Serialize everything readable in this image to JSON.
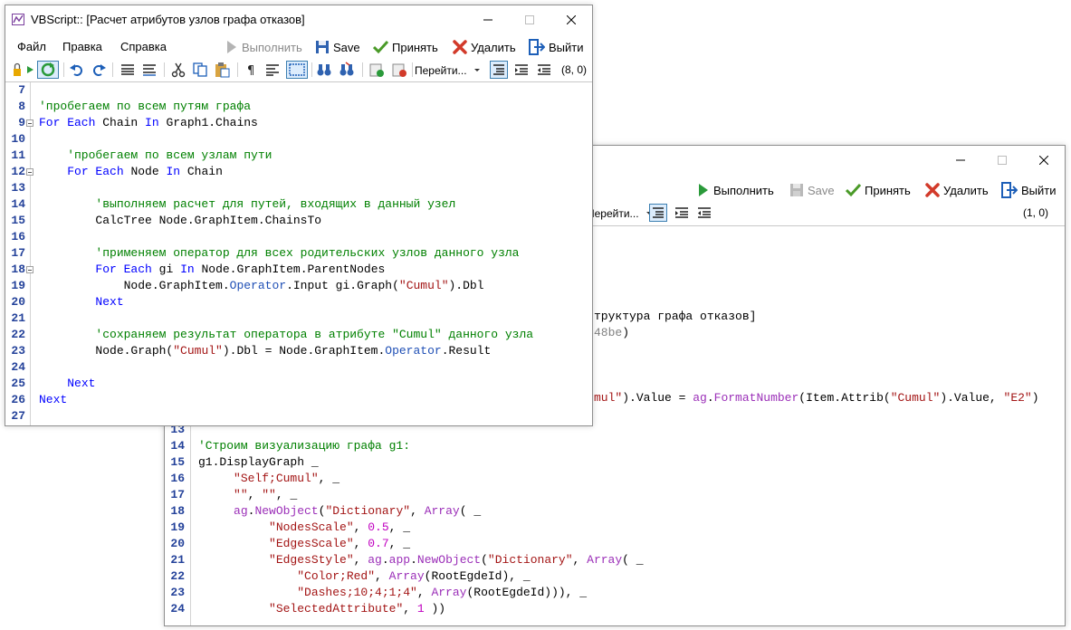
{
  "window_a": {
    "title": "VBScript:: [Расчет атрибутов узлов графа отказов]",
    "menu": [
      "Файл",
      "Правка",
      "Справка"
    ],
    "run_label": "Выполнить",
    "save_label": "Save",
    "accept_label": "Принять",
    "delete_label": "Удалить",
    "exit_label": "Выйти",
    "goto_label": "Перейти...",
    "cursor_pos": "(8, 0)",
    "lines": [
      {
        "n": "7",
        "t": [
          {
            "c": "",
            "s": ""
          }
        ]
      },
      {
        "n": "8",
        "t": [
          {
            "c": "cm",
            "s": "'пробегаем по всем путям графа"
          }
        ]
      },
      {
        "n": "9",
        "fold": true,
        "t": [
          {
            "c": "kw",
            "s": "For Each"
          },
          {
            "c": "",
            "s": " Chain "
          },
          {
            "c": "kw",
            "s": "In"
          },
          {
            "c": "",
            "s": " Graph1.Chains"
          }
        ]
      },
      {
        "n": "10",
        "t": [
          {
            "c": "",
            "s": ""
          }
        ]
      },
      {
        "n": "11",
        "t": [
          {
            "c": "cm",
            "s": "    'пробегаем по всем узлам пути"
          }
        ]
      },
      {
        "n": "12",
        "fold": true,
        "t": [
          {
            "c": "",
            "s": "    "
          },
          {
            "c": "kw",
            "s": "For Each"
          },
          {
            "c": "",
            "s": " Node "
          },
          {
            "c": "kw",
            "s": "In"
          },
          {
            "c": "",
            "s": " Chain"
          }
        ]
      },
      {
        "n": "13",
        "t": [
          {
            "c": "",
            "s": ""
          }
        ]
      },
      {
        "n": "14",
        "t": [
          {
            "c": "cm",
            "s": "        'выполняем расчет для путей, входящих в данный узел"
          }
        ]
      },
      {
        "n": "15",
        "t": [
          {
            "c": "",
            "s": "        CalcTree Node.GraphItem.ChainsTo"
          }
        ]
      },
      {
        "n": "16",
        "t": [
          {
            "c": "",
            "s": ""
          }
        ]
      },
      {
        "n": "17",
        "t": [
          {
            "c": "cm",
            "s": "        'применяем оператор для всех родительских узлов данного узла"
          }
        ]
      },
      {
        "n": "18",
        "fold": true,
        "t": [
          {
            "c": "",
            "s": "        "
          },
          {
            "c": "kw",
            "s": "For Each"
          },
          {
            "c": "",
            "s": " gi "
          },
          {
            "c": "kw",
            "s": "In"
          },
          {
            "c": "",
            "s": " Node.GraphItem.ParentNodes"
          }
        ]
      },
      {
        "n": "19",
        "t": [
          {
            "c": "",
            "s": "            Node.GraphItem."
          },
          {
            "c": "op",
            "s": "Operator"
          },
          {
            "c": "",
            "s": ".Input gi.Graph("
          },
          {
            "c": "st",
            "s": "\"Cumul\""
          },
          {
            "c": "",
            "s": ").Dbl"
          }
        ]
      },
      {
        "n": "20",
        "t": [
          {
            "c": "",
            "s": "        "
          },
          {
            "c": "kw",
            "s": "Next"
          }
        ]
      },
      {
        "n": "21",
        "t": [
          {
            "c": "",
            "s": ""
          }
        ]
      },
      {
        "n": "22",
        "t": [
          {
            "c": "cm",
            "s": "        'сохраняем результат оператора в атрибуте \"Cumul\" данного узла"
          }
        ]
      },
      {
        "n": "23",
        "t": [
          {
            "c": "",
            "s": "        Node.Graph("
          },
          {
            "c": "st",
            "s": "\"Cumul\""
          },
          {
            "c": "",
            "s": ").Dbl = Node.GraphItem."
          },
          {
            "c": "op",
            "s": "Operator"
          },
          {
            "c": "",
            "s": ".Result"
          }
        ]
      },
      {
        "n": "24",
        "t": [
          {
            "c": "",
            "s": ""
          }
        ]
      },
      {
        "n": "25",
        "t": [
          {
            "c": "",
            "s": "    "
          },
          {
            "c": "kw",
            "s": "Next"
          }
        ]
      },
      {
        "n": "26",
        "t": [
          {
            "c": "kw",
            "s": "Next"
          }
        ]
      },
      {
        "n": "27",
        "t": [
          {
            "c": "",
            "s": ""
          }
        ]
      }
    ]
  },
  "window_b": {
    "run_label": "Выполнить",
    "save_label": "Save",
    "accept_label": "Принять",
    "delete_label": "Удалить",
    "exit_label": "Выйти",
    "goto_label": "Перейти...",
    "cursor_pos": "(1, 0)",
    "visible_fragments": [
      {
        "t": [
          {
            "c": "",
            "s": "труктура графа отказов]"
          }
        ]
      },
      {
        "t": [
          {
            "c": "gray",
            "s": "48be"
          },
          {
            "c": "",
            "s": ")"
          }
        ]
      },
      {
        "t": [
          {
            "c": "st",
            "s": "mul\""
          },
          {
            "c": "",
            "s": ").Value = "
          },
          {
            "c": "ag",
            "s": "ag"
          },
          {
            "c": "",
            "s": "."
          },
          {
            "c": "ag",
            "s": "FormatNumber"
          },
          {
            "c": "",
            "s": "(Item.Attrib("
          },
          {
            "c": "st",
            "s": "\"Cumul\""
          },
          {
            "c": "",
            "s": ").Value, "
          },
          {
            "c": "st",
            "s": "\"E2\""
          },
          {
            "c": "",
            "s": ")"
          }
        ]
      }
    ],
    "lines": [
      {
        "n": "13",
        "t": [
          {
            "c": "",
            "s": ""
          }
        ]
      },
      {
        "n": "14",
        "t": [
          {
            "c": "cm",
            "s": "'Строим визуализацию графа g1:"
          }
        ]
      },
      {
        "n": "15",
        "t": [
          {
            "c": "",
            "s": "g1.DisplayGraph _"
          }
        ]
      },
      {
        "n": "16",
        "t": [
          {
            "c": "",
            "s": "     "
          },
          {
            "c": "st",
            "s": "\"Self;Cumul\""
          },
          {
            "c": "",
            "s": ", _"
          }
        ]
      },
      {
        "n": "17",
        "t": [
          {
            "c": "",
            "s": "     "
          },
          {
            "c": "st",
            "s": "\"\""
          },
          {
            "c": "",
            "s": ", "
          },
          {
            "c": "st",
            "s": "\"\""
          },
          {
            "c": "",
            "s": ", _"
          }
        ]
      },
      {
        "n": "18",
        "t": [
          {
            "c": "",
            "s": "     "
          },
          {
            "c": "ag",
            "s": "ag"
          },
          {
            "c": "",
            "s": "."
          },
          {
            "c": "ag",
            "s": "NewObject"
          },
          {
            "c": "",
            "s": "("
          },
          {
            "c": "st",
            "s": "\"Dictionary\""
          },
          {
            "c": "",
            "s": ", "
          },
          {
            "c": "ag",
            "s": "Array"
          },
          {
            "c": "",
            "s": "( _"
          }
        ]
      },
      {
        "n": "19",
        "t": [
          {
            "c": "",
            "s": "          "
          },
          {
            "c": "st",
            "s": "\"NodesScale\""
          },
          {
            "c": "",
            "s": ", "
          },
          {
            "c": "nm",
            "s": "0.5"
          },
          {
            "c": "",
            "s": ", _"
          }
        ]
      },
      {
        "n": "20",
        "t": [
          {
            "c": "",
            "s": "          "
          },
          {
            "c": "st",
            "s": "\"EdgesScale\""
          },
          {
            "c": "",
            "s": ", "
          },
          {
            "c": "nm",
            "s": "0.7"
          },
          {
            "c": "",
            "s": ", _"
          }
        ]
      },
      {
        "n": "21",
        "t": [
          {
            "c": "",
            "s": "          "
          },
          {
            "c": "st",
            "s": "\"EdgesStyle\""
          },
          {
            "c": "",
            "s": ", "
          },
          {
            "c": "ag",
            "s": "ag"
          },
          {
            "c": "",
            "s": "."
          },
          {
            "c": "ag",
            "s": "app"
          },
          {
            "c": "",
            "s": "."
          },
          {
            "c": "ag",
            "s": "NewObject"
          },
          {
            "c": "",
            "s": "("
          },
          {
            "c": "st",
            "s": "\"Dictionary\""
          },
          {
            "c": "",
            "s": ", "
          },
          {
            "c": "ag",
            "s": "Array"
          },
          {
            "c": "",
            "s": "( _"
          }
        ]
      },
      {
        "n": "22",
        "t": [
          {
            "c": "",
            "s": "              "
          },
          {
            "c": "st",
            "s": "\"Color;Red\""
          },
          {
            "c": "",
            "s": ", "
          },
          {
            "c": "ag",
            "s": "Array"
          },
          {
            "c": "",
            "s": "(RootEgdeId), _"
          }
        ]
      },
      {
        "n": "23",
        "t": [
          {
            "c": "",
            "s": "              "
          },
          {
            "c": "st",
            "s": "\"Dashes;10;4;1;4\""
          },
          {
            "c": "",
            "s": ", "
          },
          {
            "c": "ag",
            "s": "Array"
          },
          {
            "c": "",
            "s": "(RootEgdeId))), _"
          }
        ]
      },
      {
        "n": "24",
        "t": [
          {
            "c": "",
            "s": "          "
          },
          {
            "c": "st",
            "s": "\"SelectedAttribute\""
          },
          {
            "c": "",
            "s": ", "
          },
          {
            "c": "nm",
            "s": "1"
          },
          {
            "c": "",
            "s": " ))"
          }
        ]
      }
    ]
  }
}
